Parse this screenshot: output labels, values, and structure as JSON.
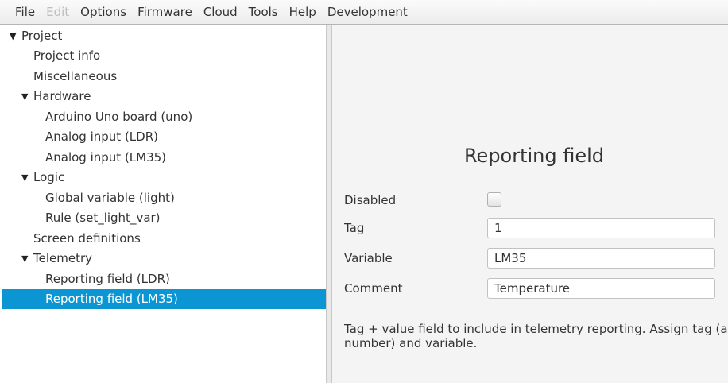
{
  "menubar": {
    "items": [
      "File",
      "Edit",
      "Options",
      "Firmware",
      "Cloud",
      "Tools",
      "Help",
      "Development"
    ]
  },
  "tree": {
    "items": [
      {
        "label": "Project",
        "expanded": true
      },
      {
        "label": "Project info"
      },
      {
        "label": "Miscellaneous"
      },
      {
        "label": "Hardware",
        "expanded": true
      },
      {
        "label": "Arduino Uno board (uno)"
      },
      {
        "label": "Analog input (LDR)"
      },
      {
        "label": "Analog input (LM35)"
      },
      {
        "label": "Logic",
        "expanded": true
      },
      {
        "label": "Global variable (light)"
      },
      {
        "label": "Rule (set_light_var)"
      },
      {
        "label": "Screen definitions"
      },
      {
        "label": "Telemetry",
        "expanded": true
      },
      {
        "label": "Reporting field (LDR)"
      },
      {
        "label": "Reporting field (LM35)",
        "selected": true
      }
    ]
  },
  "detail": {
    "title": "Reporting field",
    "disabled_label": "Disabled",
    "disabled_checked": false,
    "tag_label": "Tag",
    "tag_value": "1",
    "variable_label": "Variable",
    "variable_value": "LM35",
    "comment_label": "Comment",
    "comment_value": "Temperature",
    "description": "Tag + value field to include in telemetry reporting. Assign tag (a number) and variable."
  },
  "colors": {
    "selection": "#0b96d3",
    "background": "#f4f4f4"
  }
}
